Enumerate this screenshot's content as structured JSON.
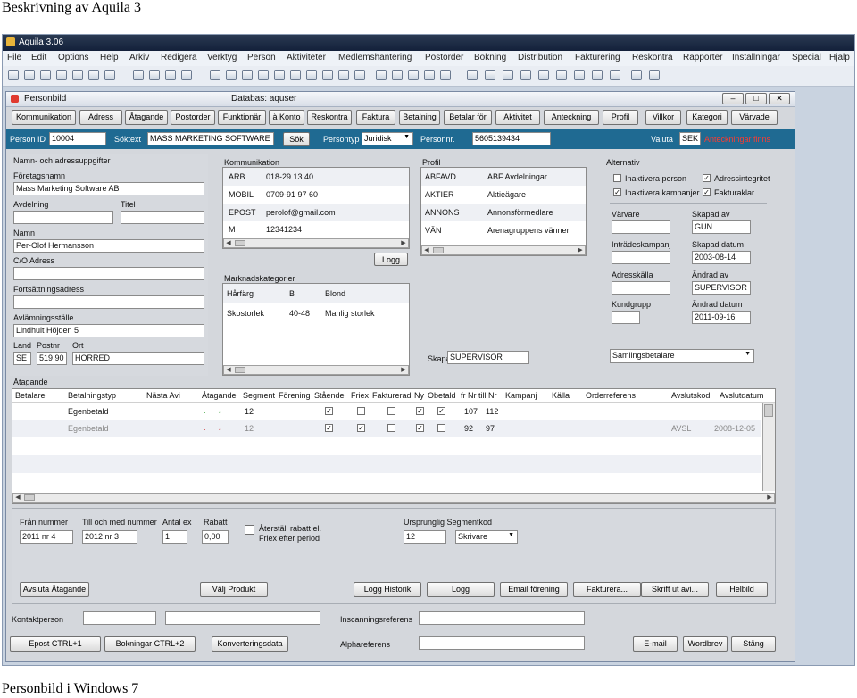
{
  "doc": {
    "title": "Beskrivning av Aquila 3",
    "caption": "Personbild i Windows 7"
  },
  "app": {
    "title": "Aquila 3.06",
    "menu": [
      "File",
      "Edit",
      "Options",
      "Help",
      "Arkiv",
      "Redigera",
      "Verktyg",
      "Person",
      "Aktiviteter",
      "Medlemshantering",
      "Postorder",
      "Bokning",
      "Distribution",
      "Fakturering",
      "Reskontra",
      "Rapporter",
      "Inställningar",
      "Special",
      "Hjälp"
    ]
  },
  "person_window": {
    "title": "Personbild",
    "database": "Databas: aquser",
    "tabs": [
      "Kommunikation",
      "Adress",
      "Åtagande",
      "Postorder",
      "Funktionär",
      "à Konto",
      "Reskontra",
      "Faktura",
      "Betalning",
      "Betalar för",
      "Aktivitet",
      "Anteckning",
      "Profil",
      "Villkor",
      "Kategori",
      "Värvade"
    ],
    "idbar": {
      "person_id_label": "Person ID",
      "person_id": "10004",
      "soktext_label": "Söktext",
      "soktext": "MASS MARKETING SOFTWARE",
      "sok_button": "Sök",
      "persontyp_label": "Persontyp",
      "persontyp": "Juridisk",
      "personnr_label": "Personnr.",
      "personnr": "5605139434",
      "valuta_label": "Valuta",
      "valuta": "SEK",
      "anteckningar": "Anteckningar finns"
    },
    "address": {
      "heading": "Namn- och adressuppgifter",
      "foretagsnamn_label": "Företagsnamn",
      "foretagsnamn": "Mass Marketing Software AB",
      "avdelning_label": "Avdelning",
      "titel_label": "Titel",
      "namn_label": "Namn",
      "namn": "Per-Olof Hermansson",
      "co_label": "C/O Adress",
      "fortsattning_label": "Fortsättningsadress",
      "avlamning_label": "Avlämningsställe",
      "avlamning": "Lindhult Höjden 5",
      "land_label": "Land",
      "postnr_label": "Postnr",
      "ort_label": "Ort",
      "land": "SE",
      "postnr": "519 90",
      "ort": "HORRED"
    },
    "kommunikation": {
      "heading": "Kommunikation",
      "rows": [
        {
          "type": "ARB",
          "value": "018-29 13 40"
        },
        {
          "type": "MOBIL",
          "value": "0709-91 97 60"
        },
        {
          "type": "EPOST",
          "value": "perolof@gmail.com"
        },
        {
          "type": "M",
          "value": "12341234"
        }
      ],
      "logg_button": "Logg"
    },
    "marknadskategorier": {
      "heading": "Marknadskategorier",
      "rows": [
        {
          "a": "Hårfärg",
          "b": "B",
          "c": "Blond"
        },
        {
          "a": "Skostorlek",
          "b": "40-48",
          "c": "Manlig storlek"
        }
      ]
    },
    "profil": {
      "heading": "Profil",
      "rows": [
        {
          "code": "ABFAVD",
          "text": "ABF Avdelningar"
        },
        {
          "code": "AKTIER",
          "text": "Aktieägare"
        },
        {
          "code": "ANNONS",
          "text": "Annonsförmedlare"
        },
        {
          "code": "VÄN",
          "text": "Arenagruppens vänner"
        }
      ],
      "skapad_av_label": "Skapad av",
      "skapad_av": "SUPERVISOR"
    },
    "alternativ": {
      "heading": "Alternativ",
      "checks": [
        {
          "label": "Inaktivera person",
          "checked": false
        },
        {
          "label": "Adressintegritet",
          "checked": true
        },
        {
          "label": "Inaktivera kampanjer",
          "checked": true
        },
        {
          "label": "Fakturaklar",
          "checked": true
        }
      ],
      "varvare_label": "Värvare",
      "skapad_av_label": "Skapad av",
      "skapad_av": "GUN",
      "intradeskampanj_label": "Inträdeskampanj",
      "skapad_datum_label": "Skapad datum",
      "skapad_datum": "2003-08-14",
      "adresskalla_label": "Adresskälla",
      "andrad_av_label": "Ändrad av",
      "andrad_av": "SUPERVISOR",
      "kundgrupp_label": "Kundgrupp",
      "andrad_datum_label": "Ändrad datum",
      "andrad_datum": "2011-09-16",
      "samlingsbetalare": "Samlingsbetalare"
    },
    "atagande": {
      "heading": "Åtagande",
      "columns": [
        "Betalare",
        "Betalningstyp",
        "Nästa Avi",
        "Åtagande",
        "Segment",
        "Förening",
        "Stående",
        "Friex",
        "Fakturerad",
        "Ny",
        "Obetald",
        "fr Nr",
        "till Nr",
        "Kampanj",
        "Källa",
        "Orderreferens",
        "Avslutskod",
        "Avslutdatum"
      ],
      "rows": [
        {
          "betalningstyp": "Egenbetald",
          "segment": "12",
          "stående": true,
          "friex": false,
          "fakturerad": false,
          "ny": true,
          "obetald": true,
          "fr": "107",
          "till": "112",
          "avslutskod": "",
          "avslutdatum": "",
          "inactive": false
        },
        {
          "betalningstyp": "Egenbetald",
          "segment": "12",
          "stående": true,
          "friex": true,
          "fakturerad": false,
          "ny": true,
          "obetald": false,
          "fr": "92",
          "till": "97",
          "avslutskod": "AVSL",
          "avslutdatum": "2008-12-05",
          "inactive": true
        }
      ]
    },
    "segment": {
      "fran_label": "Från nummer",
      "fran": "2011 nr 4",
      "till_label": "Till och med nummer",
      "till": "2012 nr 3",
      "antal_label": "Antal ex",
      "antal": "1",
      "rabatt_label": "Rabatt",
      "rabatt": "0,00",
      "aterstall_label_1": "Återställ rabatt el.",
      "aterstall_label_2": "Friex efter period",
      "ursprunglig_label": "Ursprunglig Segmentkod",
      "ursprunglig": "12",
      "skrivare": "Skrivare"
    },
    "buttons": {
      "avsluta": "Avsluta Åtagande",
      "valj_produkt": "Välj Produkt",
      "logg_historik": "Logg Historik",
      "logg": "Logg",
      "email_forening": "Email förening",
      "fakturera": "Fakturera...",
      "skrift_ut_avi": "Skrift ut avi...",
      "helbild": "Helbild",
      "epost_ctrl": "Epost CTRL+1",
      "bokningar_ctrl": "Bokningar CTRL+2",
      "konverteringsdata": "Konverteringsdata",
      "email": "E-mail",
      "wordbrev": "Wordbrev",
      "stang": "Stäng"
    },
    "bottom": {
      "kontaktperson_label": "Kontaktperson",
      "inscanning_label": "Inscanningsreferens",
      "alphareferens_label": "Alphareferens"
    }
  }
}
